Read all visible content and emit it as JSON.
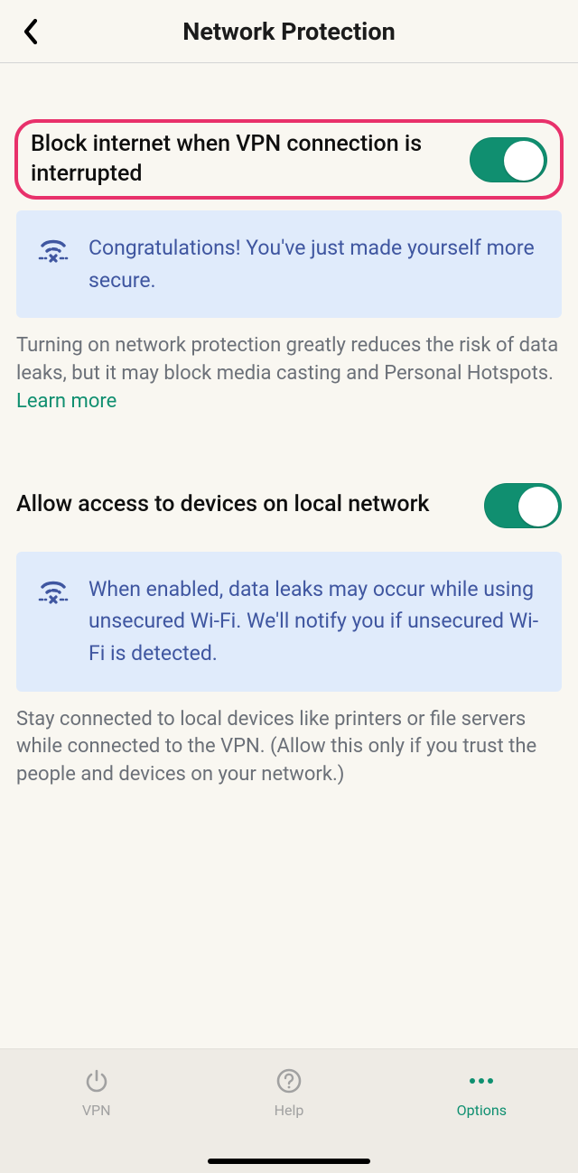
{
  "header": {
    "title": "Network Protection"
  },
  "settings": {
    "block_internet": {
      "label": "Block internet when VPN connection is interrupted",
      "on": true,
      "callout": "Congratulations! You've just made yourself more secure.",
      "desc_prefix": "Turning on network protection greatly reduces the risk of data leaks, but it may block media casting and Personal Hotspots. ",
      "desc_link": "Learn more"
    },
    "allow_local": {
      "label": "Allow access to devices on local network",
      "on": true,
      "callout": "When enabled, data leaks may occur while using unsecured Wi-Fi. We'll notify you if unsecured Wi-Fi is detected.",
      "desc": "Stay connected to local devices like printers or file servers while connected to the VPN. (Allow this only if you trust the people and devices on your network.)"
    }
  },
  "tabs": {
    "vpn": "VPN",
    "help": "Help",
    "options": "Options"
  }
}
